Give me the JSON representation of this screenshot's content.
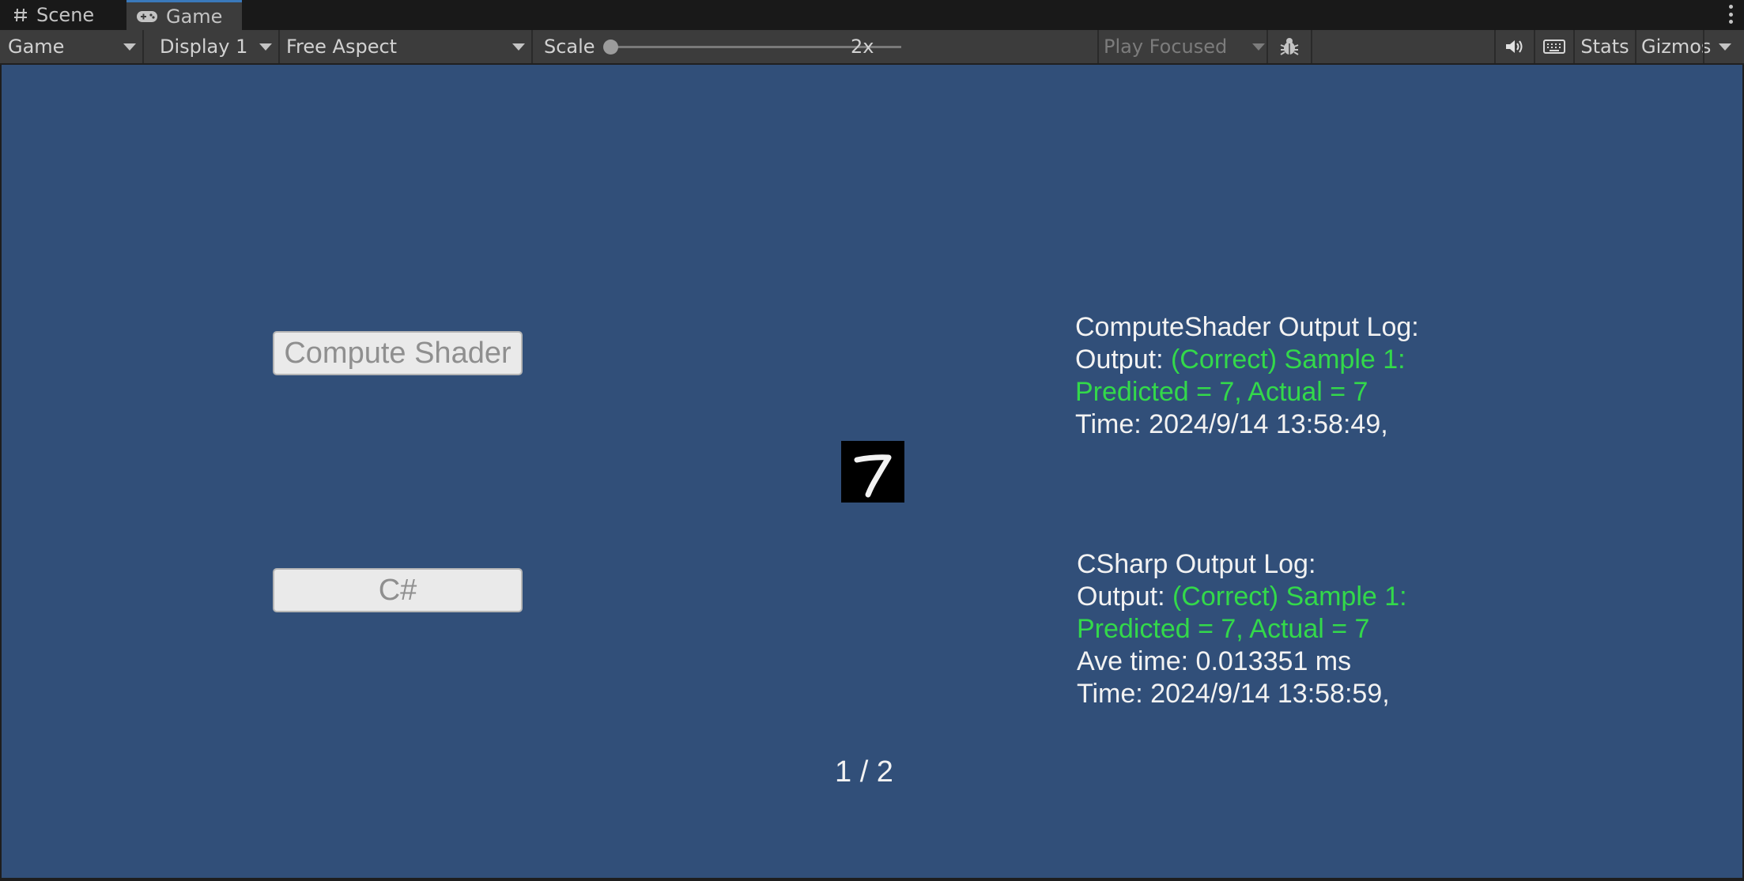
{
  "tabs": [
    {
      "label": "Scene",
      "icon": "hash-icon"
    },
    {
      "label": "Game",
      "icon": "gamepad-icon"
    }
  ],
  "toolbar": {
    "view_mode": "Game",
    "display": "Display 1",
    "aspect": "Free Aspect",
    "scale_label": "Scale",
    "scale_value": "2x",
    "play_mode": "Play Focused",
    "stats_label": "Stats",
    "gizmos_label": "Gizmos"
  },
  "game": {
    "buttons": {
      "compute_shader": "Compute Shader",
      "csharp": "C#"
    },
    "digit_label": "7",
    "compute_log": {
      "title": "ComputeShader Output Log:",
      "output_prefix": "Output:",
      "output_result": "(Correct) Sample 1:",
      "prediction": "Predicted = 7, Actual = 7",
      "time": "Time: 2024/9/14 13:58:49,"
    },
    "csharp_log": {
      "title": "CSharp Output Log:",
      "output_prefix": "Output:",
      "output_result": "(Correct) Sample 1:",
      "prediction": "Predicted = 7, Actual = 7",
      "ave_time": "Ave time: 0.013351 ms",
      "time": "Time: 2024/9/14 13:58:59,"
    },
    "page_indicator": "1 / 2"
  },
  "colors": {
    "viewport_background": "#314f79",
    "correct_text": "#33d94a",
    "log_text": "#f2f2f2",
    "active_tab_accent": "#3a79bb"
  }
}
